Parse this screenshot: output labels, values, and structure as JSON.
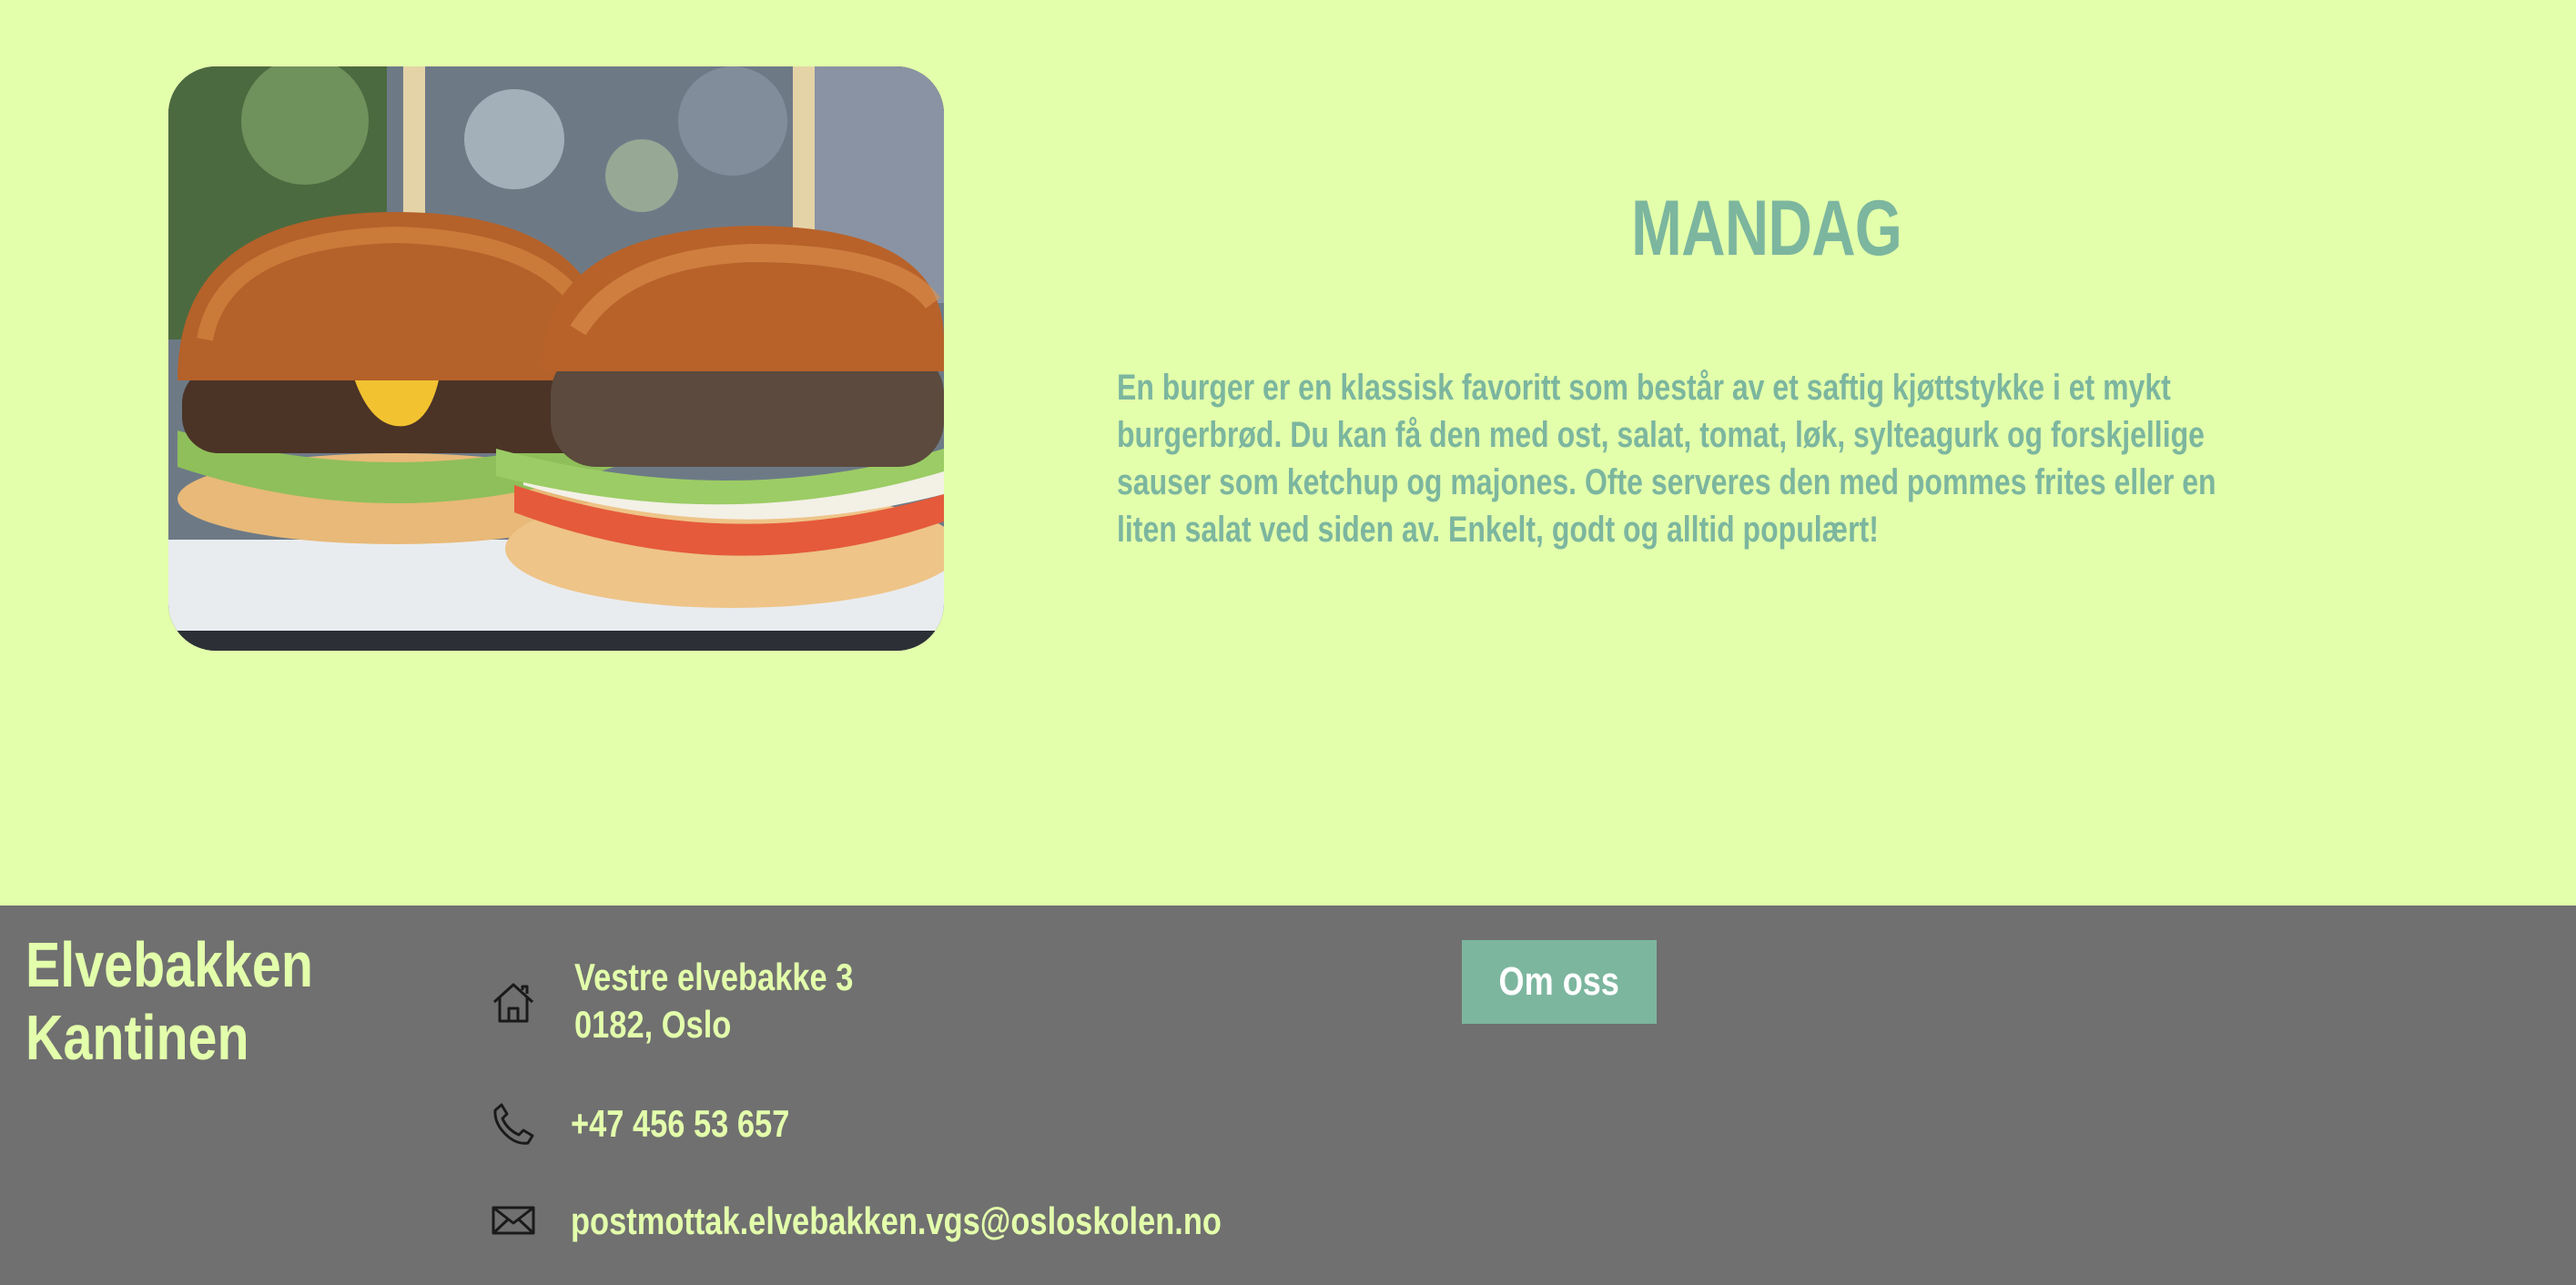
{
  "hero": {
    "image_alt": "burgers-photo",
    "day": "MANDAG",
    "description_lines": [
      "En burger er en klassisk favoritt som består av et saftig kjøttstykke i et mykt",
      "burgerbrød. Du kan få den med ost, salat, tomat, løk, sylteagurk og forskjellige",
      "sauser som ketchup og majones. Ofte serveres den med pommes frites eller en",
      "liten salat ved siden av. Enkelt, godt og alltid populært!"
    ]
  },
  "footer": {
    "brand_line1": "Elvebakken",
    "brand_line2": "Kantinen",
    "address_line1": "Vestre elvebakke 3",
    "address_line2": "0182, Oslo",
    "phone": "+47 456 53 657",
    "email": "postmottak.elvebakken.vgs@osloskolen.no",
    "about_label": "Om oss",
    "icons": [
      "home-icon",
      "phone-icon",
      "mail-icon"
    ]
  },
  "colors": {
    "page_background": "#e3ffab",
    "accent": "#7cb69f",
    "footer_background": "#707070",
    "footer_text": "#e3ffab"
  }
}
